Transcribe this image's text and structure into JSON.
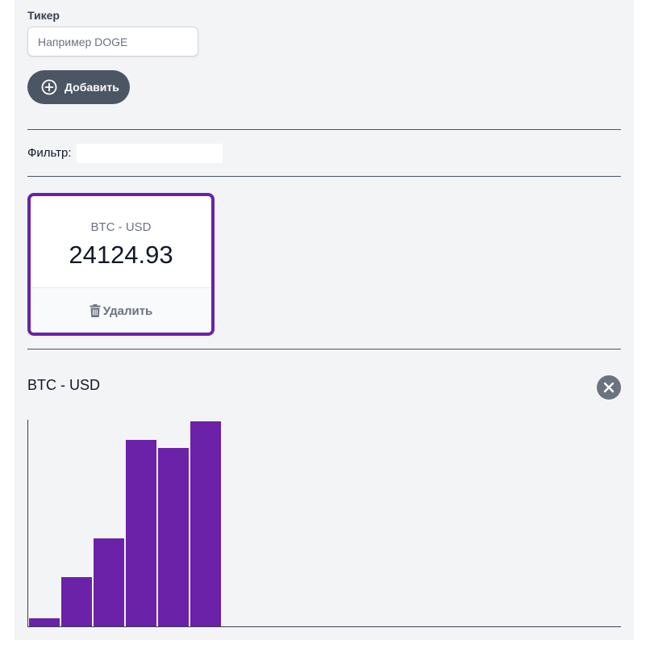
{
  "form": {
    "ticker_label": "Тикер",
    "ticker_placeholder": "Например DOGE",
    "ticker_value": "",
    "add_label": "Добавить",
    "add_icon": "plus-circle-icon"
  },
  "filter": {
    "label": "Фильтр:",
    "value": ""
  },
  "tickers": [
    {
      "name": "BTC - USD",
      "price": "24124.93",
      "delete_label": "Удалить",
      "delete_icon": "trash-icon",
      "selected": true
    }
  ],
  "graph": {
    "title": "BTC - USD",
    "close_icon": "close-icon"
  },
  "colors": {
    "accent": "#6b21a8",
    "button": "#4b5563",
    "background": "#f3f4f6"
  },
  "chart_data": {
    "type": "bar",
    "series": [
      {
        "values": [
          0.04,
          0.24,
          0.43,
          0.91,
          0.87,
          1.0
        ]
      }
    ],
    "ylim": [
      0,
      1
    ],
    "xlabel": "",
    "ylabel": "",
    "grid": false
  }
}
